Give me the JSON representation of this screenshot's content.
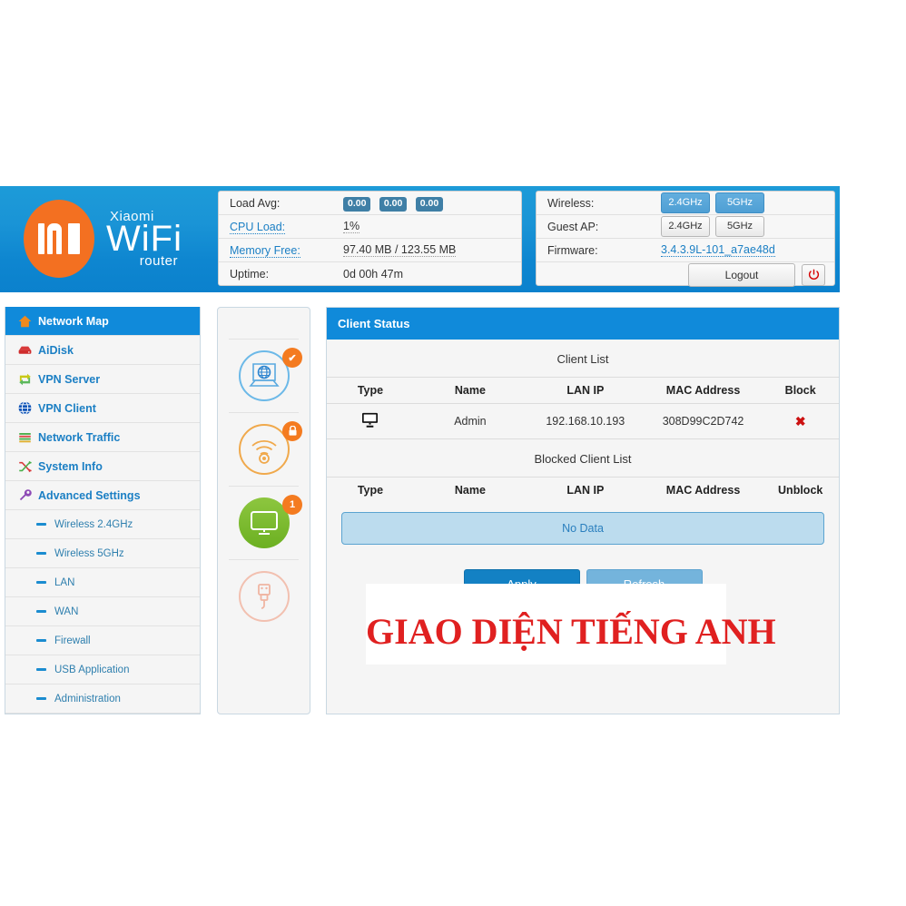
{
  "brand": {
    "xiaomi": "Xiaomi",
    "wifi": "WiFi",
    "router": "router",
    "logo_icon": "mi-logo-icon",
    "orange": "#f37021"
  },
  "status_left": {
    "load_avg_label": "Load Avg:",
    "load_avg_values": [
      "0.00",
      "0.00",
      "0.00"
    ],
    "cpu_load_label": "CPU Load:",
    "cpu_load_value": "1%",
    "memory_free_label": "Memory Free:",
    "memory_free_value": "97.40 MB / 123.55 MB",
    "uptime_label": "Uptime:",
    "uptime_value": "0d 00h 47m"
  },
  "status_right": {
    "wireless_label": "Wireless:",
    "wireless_24": "2.4GHz",
    "wireless_5": "5GHz",
    "guest_ap_label": "Guest AP:",
    "guest_24": "2.4GHz",
    "guest_5": "5GHz",
    "firmware_label": "Firmware:",
    "firmware_value": "3.4.3.9L-101_a7ae48d",
    "logout_label": "Logout",
    "power_icon": "power-icon"
  },
  "sidebar": {
    "items": [
      {
        "label": "Network Map",
        "icon": "home-icon",
        "active": true
      },
      {
        "label": "AiDisk",
        "icon": "disk-icon",
        "active": false
      },
      {
        "label": "VPN Server",
        "icon": "vpn-server-icon",
        "active": false
      },
      {
        "label": "VPN Client",
        "icon": "globe-icon",
        "active": false
      },
      {
        "label": "Network Traffic",
        "icon": "traffic-bars-icon",
        "active": false
      },
      {
        "label": "System Info",
        "icon": "shuffle-icon",
        "active": false
      },
      {
        "label": "Advanced Settings",
        "icon": "wrench-icon",
        "active": false
      }
    ],
    "sub_items": [
      {
        "label": "Wireless 2.4GHz"
      },
      {
        "label": "Wireless 5GHz"
      },
      {
        "label": "LAN"
      },
      {
        "label": "WAN"
      },
      {
        "label": "Firewall"
      },
      {
        "label": "USB Application"
      },
      {
        "label": "Administration"
      }
    ]
  },
  "icon_column": {
    "items": [
      {
        "icon": "internet-globe-icon",
        "badge": "check",
        "badge_text": "✔",
        "state": "connected"
      },
      {
        "icon": "wifi-signal-icon",
        "badge": "lock",
        "badge_text": "ὑ2",
        "state": "secured"
      },
      {
        "icon": "client-monitor-icon",
        "badge": "count",
        "badge_text": "1",
        "state": "active"
      },
      {
        "icon": "usb-device-icon",
        "badge": "none",
        "badge_text": "",
        "state": "disabled"
      }
    ]
  },
  "main": {
    "panel_title": "Client Status",
    "client_list_title": "Client List",
    "client_columns": [
      "Type",
      "Name",
      "LAN IP",
      "MAC Address",
      "Block"
    ],
    "client_rows": [
      {
        "type_icon": "monitor-icon",
        "name": "Admin",
        "lan_ip": "192.168.10.193",
        "mac": "308D99C2D742",
        "block_icon": "✖"
      }
    ],
    "blocked_list_title": "Blocked Client List",
    "blocked_columns": [
      "Type",
      "Name",
      "LAN IP",
      "MAC Address",
      "Unblock"
    ],
    "no_data_label": "No Data",
    "apply_label": "Apply",
    "refresh_label": "Refresh"
  },
  "overlay": {
    "text": "GIAO DIỆN TIẾNG ANH",
    "color": "#e02020"
  }
}
